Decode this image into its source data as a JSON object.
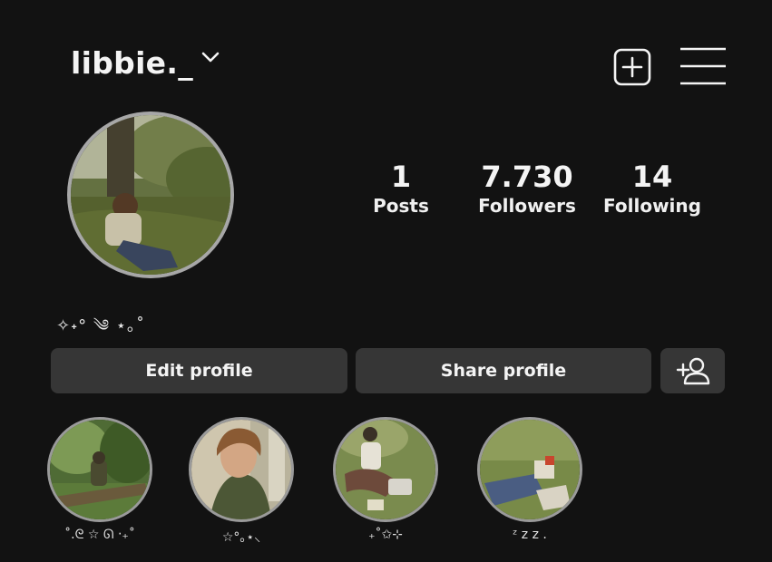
{
  "header": {
    "username": "libbie._"
  },
  "stats": {
    "posts_count": "1",
    "posts_label": "Posts",
    "followers_count": "7.730",
    "followers_label": "Followers",
    "following_count": "14",
    "following_label": "Following"
  },
  "bio": {
    "text": "✧˖° ༄ ⋆｡˚"
  },
  "actions": {
    "edit_label": "Edit profile",
    "share_label": "Share profile",
    "add_person_icon": "add-person-icon"
  },
  "highlights": [
    {
      "label": "˚.ᘓ ☆ ᘏ ‧₊˚"
    },
    {
      "label": "☆°｡⋆⸜"
    },
    {
      "label": "₊˚✩⊹"
    },
    {
      "label": "ᶻ z 𝗓 ."
    }
  ],
  "colors": {
    "background": "#121212",
    "button": "#363636",
    "ring": "#a7a7a7",
    "text": "#f4f4f4"
  }
}
